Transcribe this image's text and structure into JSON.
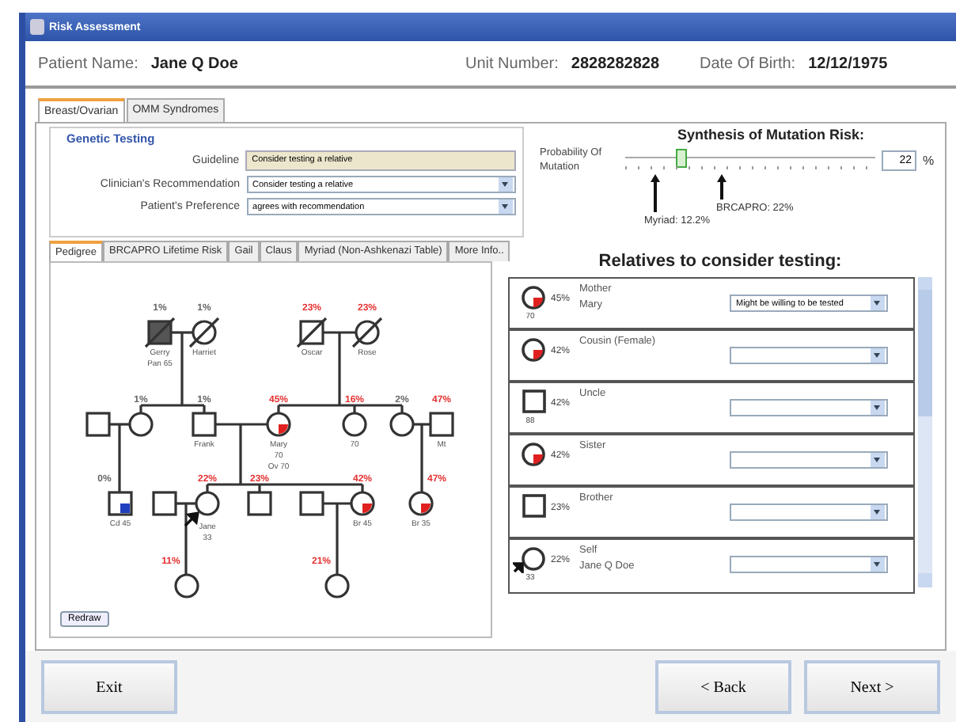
{
  "window": {
    "title": "Risk Assessment"
  },
  "patient": {
    "name_label": "Patient Name:",
    "name": "Jane Q Doe",
    "unit_label": "Unit Number:",
    "unit": "2828282828",
    "dob_label": "Date Of Birth:",
    "dob": "12/12/1975"
  },
  "tabs": [
    {
      "label": "Breast/Ovarian",
      "selected": true
    },
    {
      "label": "OMM Syndromes",
      "selected": false
    }
  ],
  "genetic_testing": {
    "title": "Genetic Testing",
    "fields": [
      {
        "kind": "readonly",
        "label": "Guideline",
        "value": "Consider testing a relative"
      },
      {
        "kind": "dropdown",
        "label": "Clinician's Recommendation",
        "value": "Consider testing a relative"
      },
      {
        "kind": "dropdown",
        "label": "Patient's Preference",
        "value": "agrees with recommendation"
      }
    ]
  },
  "synthesis": {
    "title": "Synthesis of Mutation Risk:",
    "label": "Probability Of Mutation",
    "level": 0.22,
    "value": "22",
    "unit": "%",
    "markers": [
      {
        "label": "Myriad: 12.2%"
      },
      {
        "label": "BRCAPRO: 22%"
      }
    ]
  },
  "subtabs": [
    {
      "label": "Pedigree",
      "selected": true
    },
    {
      "label": "BRCAPRO Lifetime Risk",
      "selected": false
    },
    {
      "label": "Gail",
      "selected": false
    },
    {
      "label": "Claus",
      "selected": false
    },
    {
      "label": "Myriad (Non-Ashkenazi Table)",
      "selected": false
    },
    {
      "label": "More Info..",
      "selected": false
    }
  ],
  "pedigree": {
    "nodes": [
      {
        "kind": "male",
        "risk": "1%",
        "risk_highlight": false,
        "labels": [
          "Gerry",
          "Pan 65"
        ],
        "deceased": true,
        "shaded": true,
        "proband": false
      },
      {
        "kind": "female",
        "risk": "1%",
        "risk_highlight": false,
        "labels": [
          "Harriet"
        ],
        "deceased": true,
        "shaded": false,
        "proband": false
      },
      {
        "kind": "male",
        "risk": "23%",
        "risk_highlight": true,
        "labels": [
          "Oscar"
        ],
        "deceased": true,
        "shaded": false,
        "proband": false
      },
      {
        "kind": "female",
        "risk": "23%",
        "risk_highlight": true,
        "labels": [
          "Rose"
        ],
        "deceased": true,
        "shaded": false,
        "proband": false
      },
      {
        "kind": "male",
        "deceased": false,
        "shaded": false,
        "proband": false
      },
      {
        "kind": "female",
        "risk": "1%",
        "risk_highlight": false,
        "deceased": false,
        "shaded": false,
        "proband": false
      },
      {
        "kind": "male",
        "risk": "1%",
        "risk_highlight": false,
        "labels": [
          "Frank"
        ],
        "deceased": false,
        "shaded": false,
        "proband": false
      },
      {
        "kind": "female",
        "risk": "45%",
        "risk_highlight": true,
        "labels": [
          "Mary",
          "70",
          "Ov 70"
        ],
        "deceased": false,
        "shaded": false,
        "proband": false,
        "color": "#e02020"
      },
      {
        "kind": "female",
        "risk": "16%",
        "risk_highlight": true,
        "labels": [
          "70"
        ],
        "deceased": false,
        "shaded": false,
        "proband": false
      },
      {
        "kind": "female",
        "risk": "2%",
        "risk_highlight": false,
        "deceased": false,
        "shaded": false,
        "proband": false
      },
      {
        "kind": "male",
        "risk": "47%",
        "risk_highlight": true,
        "labels": [
          "Mt"
        ],
        "deceased": false,
        "shaded": false,
        "proband": false
      },
      {
        "kind": "male",
        "risk": "0%",
        "risk_highlight": false,
        "labels": [
          "Cd 45"
        ],
        "deceased": false,
        "shaded": false,
        "proband": false,
        "color": "#2040c0"
      },
      {
        "kind": "male",
        "deceased": false,
        "shaded": false,
        "proband": false
      },
      {
        "kind": "female",
        "risk": "22%",
        "risk_highlight": true,
        "labels": [
          "Jane",
          "33"
        ],
        "deceased": false,
        "shaded": false,
        "proband": true
      },
      {
        "kind": "male",
        "risk": "23%",
        "risk_highlight": true,
        "deceased": false,
        "shaded": false,
        "proband": false
      },
      {
        "kind": "male",
        "deceased": false,
        "shaded": false,
        "proband": false
      },
      {
        "kind": "female",
        "risk": "42%",
        "risk_highlight": true,
        "labels": [
          "Br 45"
        ],
        "deceased": false,
        "shaded": false,
        "proband": false,
        "color": "#e02020"
      },
      {
        "kind": "female",
        "risk": "47%",
        "risk_highlight": true,
        "labels": [
          "Br 35"
        ],
        "deceased": false,
        "shaded": false,
        "proband": false,
        "color": "#e02020"
      },
      {
        "kind": "female",
        "risk": "11%",
        "risk_highlight": true,
        "deceased": false,
        "shaded": false,
        "proband": false
      },
      {
        "kind": "female",
        "risk": "21%",
        "risk_highlight": true,
        "deceased": false,
        "shaded": false,
        "proband": false
      }
    ],
    "redraw": "Redraw"
  },
  "relatives": {
    "title": "Relatives to consider testing:",
    "rows": [
      {
        "kind": "female",
        "color": "#e02020",
        "proband": false,
        "age": "70",
        "risk": "45%",
        "relation": "Mother",
        "name": "Mary",
        "choice": "Might be willing to be tested"
      },
      {
        "kind": "female",
        "color": "#e02020",
        "proband": false,
        "risk": "42%",
        "relation": "Cousin (Female)"
      },
      {
        "kind": "male",
        "proband": false,
        "age": "88",
        "risk": "42%",
        "relation": "Uncle"
      },
      {
        "kind": "female",
        "color": "#e02020",
        "proband": false,
        "risk": "42%",
        "relation": "Sister"
      },
      {
        "kind": "male",
        "proband": false,
        "risk": "23%",
        "relation": "Brother"
      },
      {
        "kind": "female",
        "proband": true,
        "age": "33",
        "risk": "22%",
        "relation": "Self",
        "name": "Jane Q Doe"
      }
    ]
  },
  "buttons": {
    "exit": "Exit",
    "back": "< Back",
    "next": "Next >"
  }
}
